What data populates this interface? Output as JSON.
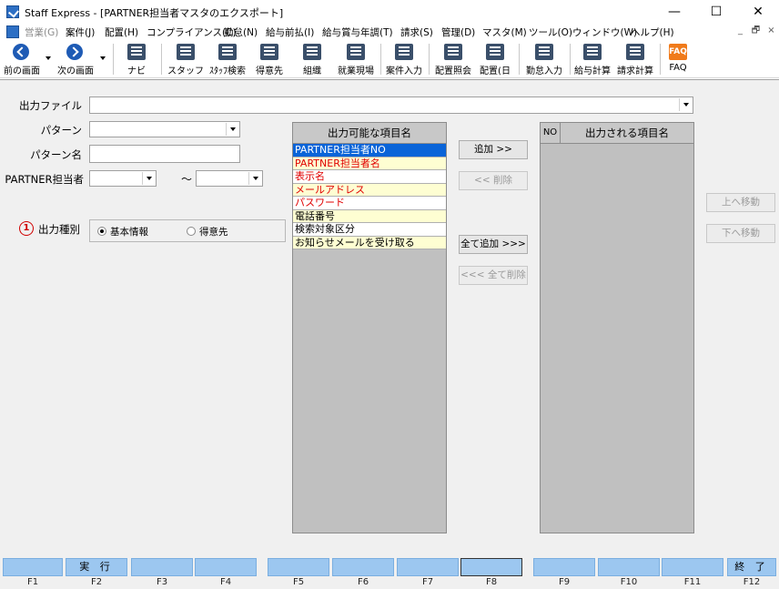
{
  "window": {
    "title": "Staff Express - [PARTNER担当者マスタのエクスポート]",
    "minimize_glyph": "—",
    "maximize_glyph": "☐",
    "close_glyph": "✕"
  },
  "menu": {
    "items": [
      {
        "label": "営業(G)",
        "disabled": true
      },
      {
        "label": "案件(J)",
        "disabled": false
      },
      {
        "label": "配置(H)",
        "disabled": false
      },
      {
        "label": "コンプライアンス(C)",
        "disabled": false
      },
      {
        "label": "勤怠(N)",
        "disabled": false
      },
      {
        "label": "給与前払(I)",
        "disabled": false
      },
      {
        "label": "給与賞与年調(T)",
        "disabled": false
      },
      {
        "label": "請求(S)",
        "disabled": false
      },
      {
        "label": "管理(D)",
        "disabled": false
      },
      {
        "label": "マスタ(M)",
        "disabled": false
      },
      {
        "label": "ツール(O)",
        "disabled": false
      },
      {
        "label": "ウィンドウ(W)",
        "disabled": false
      },
      {
        "label": "ヘルプ(H)",
        "disabled": false
      }
    ],
    "mdi_min": "_",
    "mdi_restore": "🗗",
    "mdi_close": "×"
  },
  "toolbar": {
    "items": [
      {
        "label": "前の画面",
        "icon": "back-arrow-icon"
      },
      {
        "label": "次の画面",
        "icon": "forward-arrow-icon"
      },
      {
        "label": "ナビ",
        "icon": "navi-icon"
      },
      {
        "label": "スタッフ",
        "icon": "staff-icon"
      },
      {
        "label": "ｽﾀｯﾌ検索",
        "icon": "staff-search-icon"
      },
      {
        "label": "得意先",
        "icon": "customer-icon"
      },
      {
        "label": "組織",
        "icon": "organization-icon"
      },
      {
        "label": "就業現場",
        "icon": "worksite-icon"
      },
      {
        "label": "案件入力",
        "icon": "job-entry-icon"
      },
      {
        "label": "配置照会",
        "icon": "placement-inquiry-icon"
      },
      {
        "label": "配置(日",
        "icon": "placement-daily-icon"
      },
      {
        "label": "勤怠入力",
        "icon": "attendance-entry-icon"
      },
      {
        "label": "給与計算",
        "icon": "payroll-icon"
      },
      {
        "label": "請求計算",
        "icon": "billing-icon"
      },
      {
        "label": "FAQ",
        "icon": "faq-icon",
        "icon_text": "FAQ"
      }
    ]
  },
  "form": {
    "output_file_label": "出力ファイル",
    "output_file_value": "",
    "pattern_label": "パターン",
    "pattern_value": "",
    "pattern_name_label": "パターン名",
    "pattern_name_value": "",
    "partner_label": "PARTNER担当者",
    "partner_from": "",
    "partner_to": "",
    "range_sep": "～",
    "output_type_num": "1",
    "output_type_label": "出力種別",
    "output_type_options": [
      {
        "label": "基本情報",
        "checked": true
      },
      {
        "label": "得意先",
        "checked": false
      }
    ]
  },
  "available_list": {
    "header": "出力可能な項目名",
    "items": [
      {
        "label": "PARTNER担当者NO",
        "selected": true,
        "required": false,
        "bg": "white"
      },
      {
        "label": "PARTNER担当者名",
        "selected": false,
        "required": true,
        "bg": "yellow"
      },
      {
        "label": "表示名",
        "selected": false,
        "required": true,
        "bg": "white"
      },
      {
        "label": "メールアドレス",
        "selected": false,
        "required": true,
        "bg": "yellow"
      },
      {
        "label": "パスワード",
        "selected": false,
        "required": true,
        "bg": "white"
      },
      {
        "label": "電話番号",
        "selected": false,
        "required": false,
        "bg": "yellow"
      },
      {
        "label": "検索対象区分",
        "selected": false,
        "required": false,
        "bg": "white"
      },
      {
        "label": "お知らせメールを受け取る",
        "selected": false,
        "required": false,
        "bg": "yellow"
      }
    ]
  },
  "buttons": {
    "add": "追加 >>",
    "remove": "<< 削除",
    "add_all": "全て追加 >>>",
    "remove_all": "<<< 全て削除",
    "move_up": "上へ移動",
    "move_down": "下へ移動"
  },
  "output_list": {
    "col_no": "NO",
    "header": "出力される項目名"
  },
  "fkeys": [
    {
      "key": "F1",
      "label": ""
    },
    {
      "key": "F2",
      "label": "実 行"
    },
    {
      "key": "F3",
      "label": ""
    },
    {
      "key": "F4",
      "label": ""
    },
    {
      "key": "F5",
      "label": ""
    },
    {
      "key": "F6",
      "label": ""
    },
    {
      "key": "F7",
      "label": ""
    },
    {
      "key": "F8",
      "label": ""
    },
    {
      "key": "F9",
      "label": ""
    },
    {
      "key": "F10",
      "label": ""
    },
    {
      "key": "F11",
      "label": ""
    },
    {
      "key": "F12",
      "label": "終 了"
    }
  ]
}
